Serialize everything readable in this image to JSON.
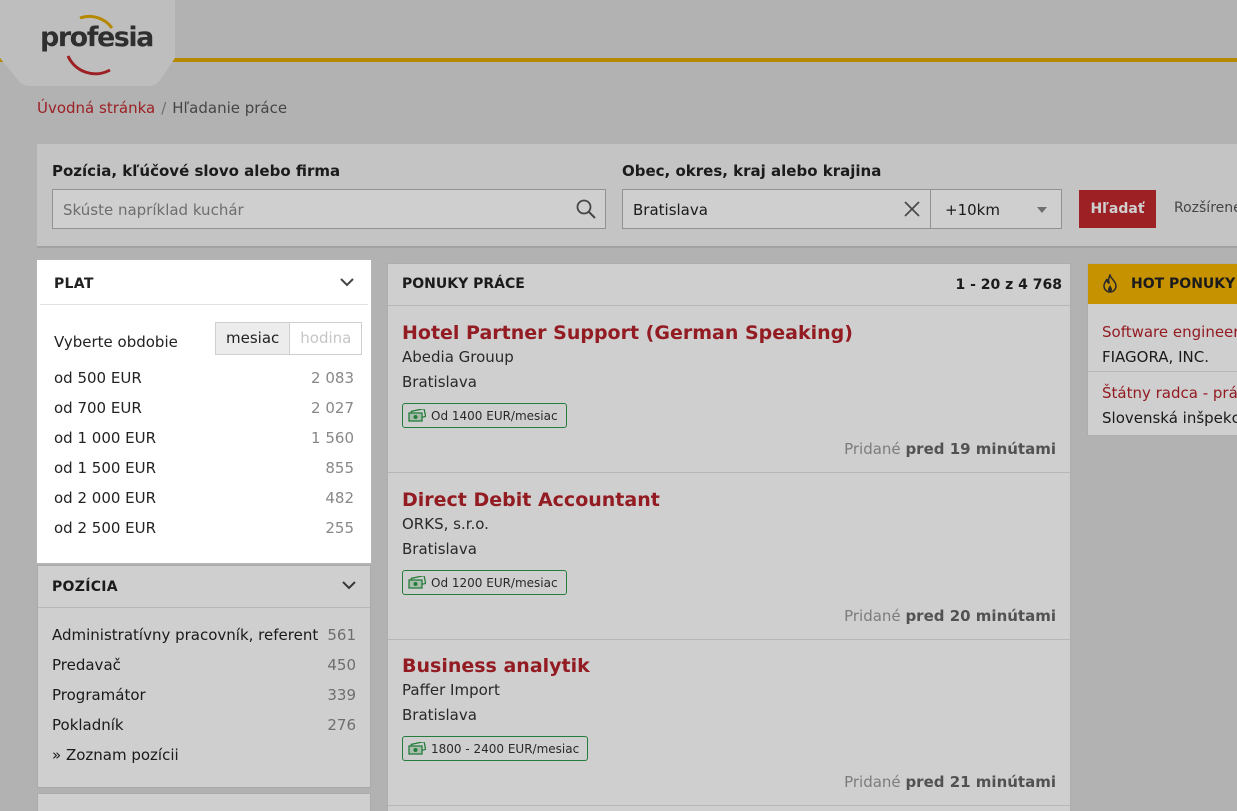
{
  "brand": {
    "logo_text": "profesia",
    "accent": "#e0a800",
    "red": "#c0282d"
  },
  "breadcrumb": {
    "home": "Úvodná stránka",
    "separator": "/",
    "current": "Hľadanie práce"
  },
  "search": {
    "keyword_label": "Pozícia, kľúčové slovo alebo firma",
    "keyword_placeholder": "Skúste napríklad kuchár",
    "location_label": "Obec, okres, kraj alebo krajina",
    "location_value": "Bratislava",
    "radius_value": "+10km",
    "button_label": "Hľadať",
    "advanced_label": "Rozšírené"
  },
  "salary_filter": {
    "title": "PLAT",
    "period_label": "Vyberte obdobie",
    "period_options": [
      "mesiac",
      "hodina"
    ],
    "period_selected": "mesiac",
    "items": [
      {
        "label": "od 500 EUR",
        "count": "2 083"
      },
      {
        "label": "od 700 EUR",
        "count": "2 027"
      },
      {
        "label": "od 1 000 EUR",
        "count": "1 560"
      },
      {
        "label": "od 1 500 EUR",
        "count": "855"
      },
      {
        "label": "od 2 000 EUR",
        "count": "482"
      },
      {
        "label": "od 2 500 EUR",
        "count": "255"
      }
    ]
  },
  "position_filter": {
    "title": "POZÍCIA",
    "items": [
      {
        "label": "Administratívny pracovník, referent",
        "count": "561"
      },
      {
        "label": "Predavač",
        "count": "450"
      },
      {
        "label": "Programátor",
        "count": "339"
      },
      {
        "label": "Pokladník",
        "count": "276"
      }
    ],
    "list_link": "» Zoznam pozícii"
  },
  "listings": {
    "title": "PONUKY PRÁCE",
    "count": "1 - 20 z 4 768",
    "added_prefix": "Pridané",
    "jobs": [
      {
        "title": "Hotel Partner Support (German Speaking)",
        "company": "Abedia Grouup",
        "location": "Bratislava",
        "salary": "Od 1400 EUR/mesiac",
        "added": "pred 19 minútami"
      },
      {
        "title": "Direct Debit Accountant",
        "company": "ORKS, s.r.o.",
        "location": "Bratislava",
        "salary": "Od 1200 EUR/mesiac",
        "added": "pred 20 minútami"
      },
      {
        "title": "Business analytik",
        "company": "Paffer Import",
        "location": "Bratislava",
        "salary": "1800 - 2400 EUR/mesiac",
        "added": "pred 21 minútami"
      }
    ]
  },
  "hot_offers": {
    "title": "HOT PONUKY",
    "items": [
      {
        "title": "Software engineer f",
        "company": "FIAGORA, INC."
      },
      {
        "title": "Štátny radca - právn",
        "company": "Slovenská inšpekcia"
      }
    ]
  }
}
